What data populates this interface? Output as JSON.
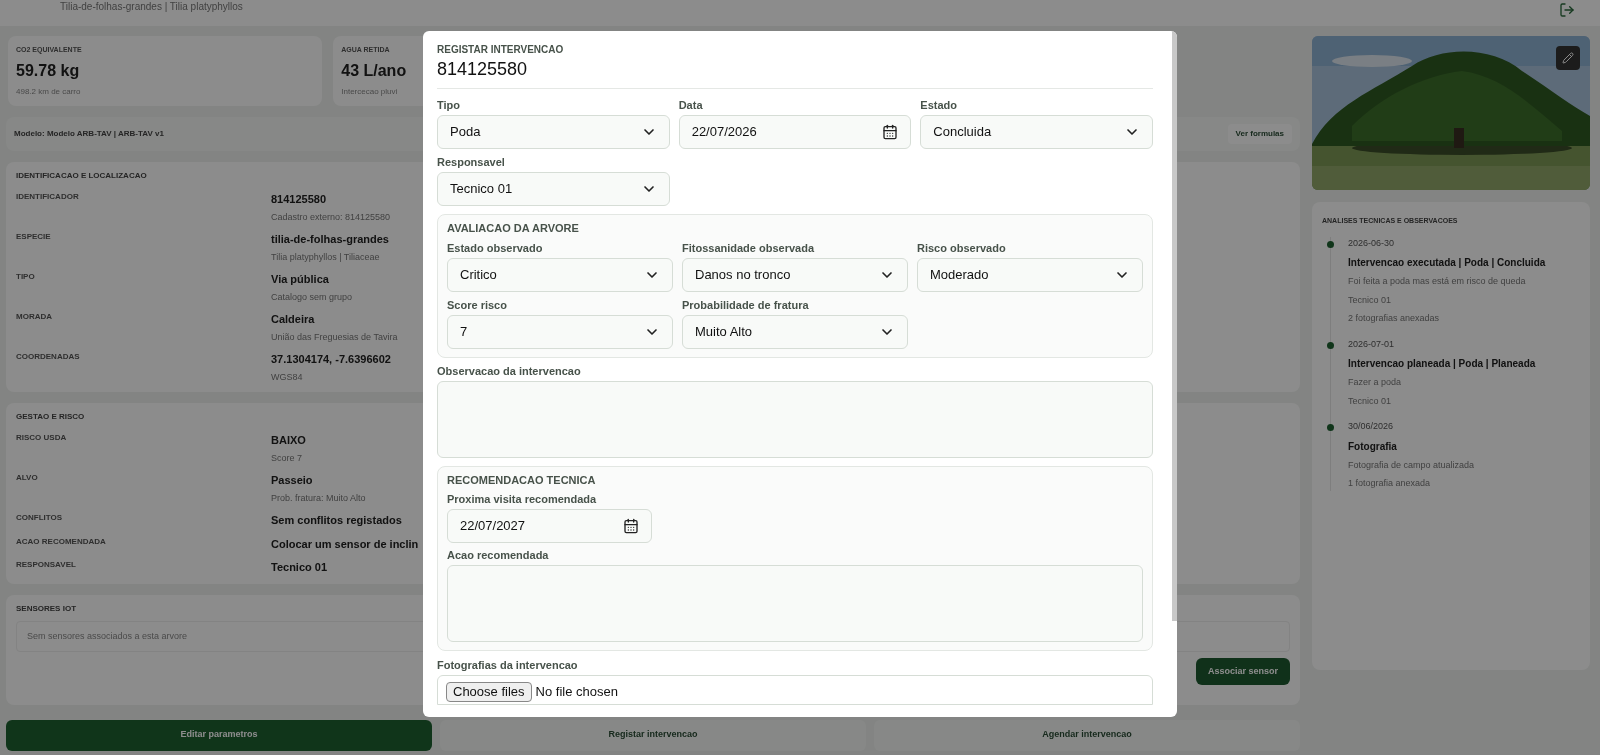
{
  "header": {
    "subtitle": "Tilia-de-folhas-grandes | Tilia platyphyllos"
  },
  "metrics": [
    {
      "label": "CO2 EQUIVALENTE",
      "value": "59.78 kg",
      "note": "498.2 km de carro"
    },
    {
      "label": "AGUA RETIDA",
      "value": "43 L/ano",
      "note": "Intercecao pluvi"
    }
  ],
  "model_bar": {
    "text": "Modelo: Modelo ARB-TAV | ARB-TAV v1",
    "button": "Ver formulas"
  },
  "identification": {
    "title": "IDENTIFICACAO E LOCALIZACAO",
    "rows": [
      {
        "label": "IDENTIFICADOR",
        "value": "814125580",
        "note": "Cadastro externo: 814125580"
      },
      {
        "label": "ESPECIE",
        "value": "tilia-de-folhas-grandes",
        "note": "Tilia platyphyllos | Tiliaceae"
      },
      {
        "label": "TIPO",
        "value": "Via pública",
        "note": "Catalogo sem grupo"
      },
      {
        "label": "MORADA",
        "value": "Caldeira",
        "note": "União das Freguesias de Tavira"
      },
      {
        "label": "COORDENADAS",
        "value": "37.1304174, -7.6396602",
        "note": "WGS84"
      }
    ]
  },
  "management": {
    "title": "GESTAO E RISCO",
    "rows": [
      {
        "label": "RISCO USDA",
        "value": "BAIXO",
        "note": "Score 7"
      },
      {
        "label": "ALVO",
        "value": "Passeio",
        "note": "Prob. fratura: Muito Alto"
      },
      {
        "label": "CONFLITOS",
        "value": "Sem conflitos registados"
      },
      {
        "label": "ACAO RECOMENDADA",
        "value": "Colocar um sensor de inclin"
      },
      {
        "label": "RESPONSAVEL",
        "value": "Tecnico 01"
      }
    ]
  },
  "sensors": {
    "title": "SENSORES IOT",
    "empty": "Sem sensores associados a esta arvore",
    "button": "Associar sensor"
  },
  "actions": [
    {
      "label": "Editar parametros",
      "primary": true
    },
    {
      "label": "Registar intervencao",
      "primary": false
    },
    {
      "label": "Agendar intervencao",
      "primary": false
    }
  ],
  "analyses": {
    "title": "ANALISES TECNICAS E OBSERVACOES",
    "items": [
      {
        "date": "2026-06-30",
        "title": "Intervencao executada | Poda | Concluida",
        "lines": [
          "Foi feita a poda mas está em risco de queda",
          "Tecnico 01",
          "2 fotografias anexadas"
        ]
      },
      {
        "date": "2026-07-01",
        "title": "Intervencao planeada | Poda | Planeada",
        "lines": [
          "Fazer a poda",
          "Tecnico 01"
        ]
      },
      {
        "date": "30/06/2026",
        "title": "Fotografia",
        "lines": [
          "Fotografia de campo atualizada",
          "1 fotografia anexada"
        ]
      }
    ]
  },
  "modal": {
    "kicker": "REGISTAR INTERVENCAO",
    "title": "814125580",
    "fields": [
      {
        "label": "Tipo",
        "kind": "select",
        "value": "Poda"
      },
      {
        "label": "Data",
        "kind": "date",
        "value": "22/07/2026"
      },
      {
        "label": "Estado",
        "kind": "select",
        "value": "Concluida"
      },
      {
        "label": "Responsavel",
        "kind": "select",
        "value": "Tecnico 01"
      }
    ],
    "assessment": {
      "title": "AVALIACAO DA ARVORE",
      "fields": [
        {
          "label": "Estado observado",
          "kind": "select",
          "value": "Critico"
        },
        {
          "label": "Fitossanidade observada",
          "kind": "select",
          "value": "Danos no tronco"
        },
        {
          "label": "Risco observado",
          "kind": "select",
          "value": "Moderado"
        },
        {
          "label": "Score risco",
          "kind": "select",
          "value": "7"
        },
        {
          "label": "Probabilidade de fratura",
          "kind": "select",
          "value": "Muito Alto"
        }
      ]
    },
    "observation": {
      "label": "Observacao da intervencao"
    },
    "recommendation": {
      "title": "RECOMENDACAO TECNICA",
      "fields": [
        {
          "label": "Proxima visita recomendada",
          "kind": "date",
          "value": "22/07/2027"
        },
        {
          "label": "Acao recomendada",
          "kind": "textarea"
        }
      ]
    },
    "photos": {
      "label": "Fotografias da intervencao",
      "button": "Choose files",
      "status": "No file chosen"
    }
  }
}
